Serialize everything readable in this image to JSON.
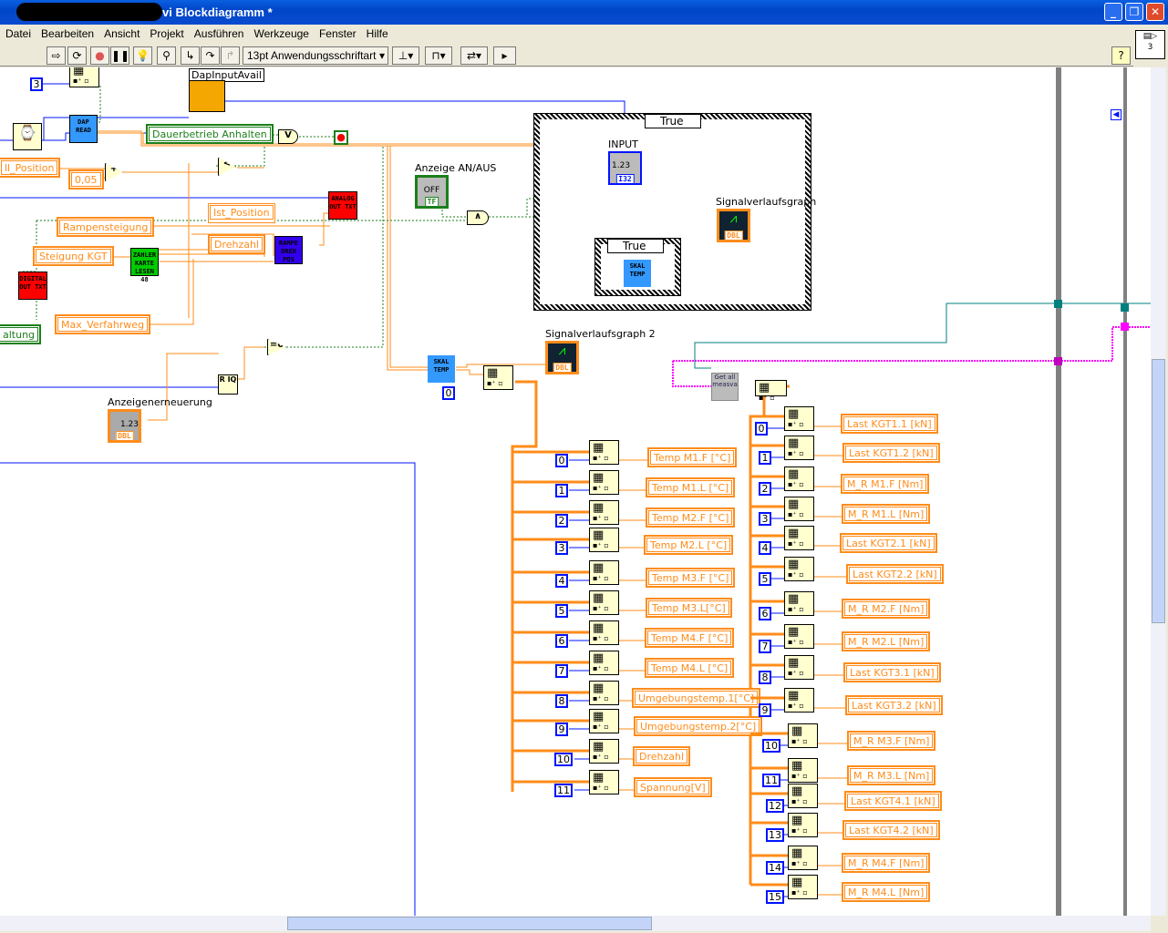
{
  "window": {
    "title": "vi Blockdiagramm *",
    "buttons": [
      "minimize",
      "restore",
      "close"
    ]
  },
  "menu": [
    "Datei",
    "Bearbeiten",
    "Ansicht",
    "Projekt",
    "Ausführen",
    "Werkzeuge",
    "Fenster",
    "Hilfe"
  ],
  "toolbar": {
    "font": "13pt Anwendungsschriftart",
    "icons": [
      "run-arrow",
      "run-continuously",
      "abort",
      "pause",
      "highlight-execution",
      "retain-wire-values",
      "step-into",
      "step-over",
      "step-out",
      "align",
      "distribute",
      "reorder",
      "cleanup"
    ],
    "help": "?",
    "context_help_number": "3"
  },
  "diagram": {
    "const_3": "3",
    "dap_input_avail": "DapInputAvail",
    "dap_read": "DAP\nREAD",
    "dauerbetrieb": "Dauerbetrieb Anhalten",
    "soll_position": "ll_Position",
    "const_005": "0,05",
    "ist_position": "Ist_Position",
    "analog_out": "ANALOG OUT TXT",
    "rampensteigung": "Rampensteigung",
    "drehzahl": "Drehzahl",
    "rampe": "RAMPE DREH POS",
    "steigung": "Steigung KGT",
    "zaehler": "ZAHLER KARTE LESEN 48",
    "digital_out": "DIGITAL OUT TXT",
    "schaltung": "altung",
    "max_verfahrweg": "Max_Verfahrweg",
    "anzeige_anaus": "Anzeige AN/AUS",
    "off": "OFF",
    "tf": "TF",
    "case_true": "True",
    "input": "INPUT",
    "num": "1.23",
    "i32": "I32",
    "signalgraph": "Signalverlaufsgraph",
    "signalgraph2": "Signalverlaufsgraph 2",
    "dbl": "DBL",
    "skal_temp": "SKAL TEMP",
    "anzeigenerneuerung": "Anzeigenerneuerung",
    "const_0": "0",
    "get_all": "Get all measva",
    "or": "V",
    "and": "∧",
    "eq0": "=0",
    "less": "<",
    "plus": "+",
    "rq": "R IQ"
  },
  "left_rows": [
    {
      "index": "0",
      "label": "Temp M1.F [°C]"
    },
    {
      "index": "1",
      "label": "Temp M1.L [°C]"
    },
    {
      "index": "2",
      "label": "Temp M2.F [°C]"
    },
    {
      "index": "3",
      "label": "Temp M2.L [°C]"
    },
    {
      "index": "4",
      "label": "Temp M3.F [°C]"
    },
    {
      "index": "5",
      "label": "Temp M3.L[°C]"
    },
    {
      "index": "6",
      "label": "Temp M4.F [°C]"
    },
    {
      "index": "7",
      "label": "Temp M4.L [°C]"
    },
    {
      "index": "8",
      "label": "Umgebungstemp.1[°C]"
    },
    {
      "index": "9",
      "label": "Umgebungstemp.2[°C]"
    },
    {
      "index": "10",
      "label": "Drehzahl"
    },
    {
      "index": "11",
      "label": "Spannung[V]"
    }
  ],
  "right_rows": [
    {
      "index": "0",
      "label": "Last KGT1.1 [kN]"
    },
    {
      "index": "1",
      "label": "Last KGT1.2 [kN]"
    },
    {
      "index": "2",
      "label": "M_R M1.F [Nm]"
    },
    {
      "index": "3",
      "label": "M_R M1.L [Nm]"
    },
    {
      "index": "4",
      "label": "Last KGT2.1 [kN]"
    },
    {
      "index": "5",
      "label": "Last KGT2.2 [kN]"
    },
    {
      "index": "6",
      "label": "M_R M2.F [Nm]"
    },
    {
      "index": "7",
      "label": "M_R M2.L [Nm]"
    },
    {
      "index": "8",
      "label": "Last KGT3.1 [kN]"
    },
    {
      "index": "9",
      "label": "Last KGT3.2 [kN]"
    },
    {
      "index": "10",
      "label": "M_R M3.F [Nm]"
    },
    {
      "index": "11",
      "label": "M_R M3.L [Nm]"
    },
    {
      "index": "12",
      "label": "Last KGT4.1 [kN]"
    },
    {
      "index": "13",
      "label": "Last KGT4.2 [kN]"
    },
    {
      "index": "14",
      "label": "M_R M4.F [Nm]"
    },
    {
      "index": "15",
      "label": "M_R M4.L [Nm]"
    }
  ],
  "colors": {
    "dbl_wire": "#ff8c1a",
    "int_wire": "#0014ff",
    "bool_wire": "#1b7f1b",
    "cluster_wire": "#ff00ff",
    "ref_wire": "#007f7f"
  }
}
